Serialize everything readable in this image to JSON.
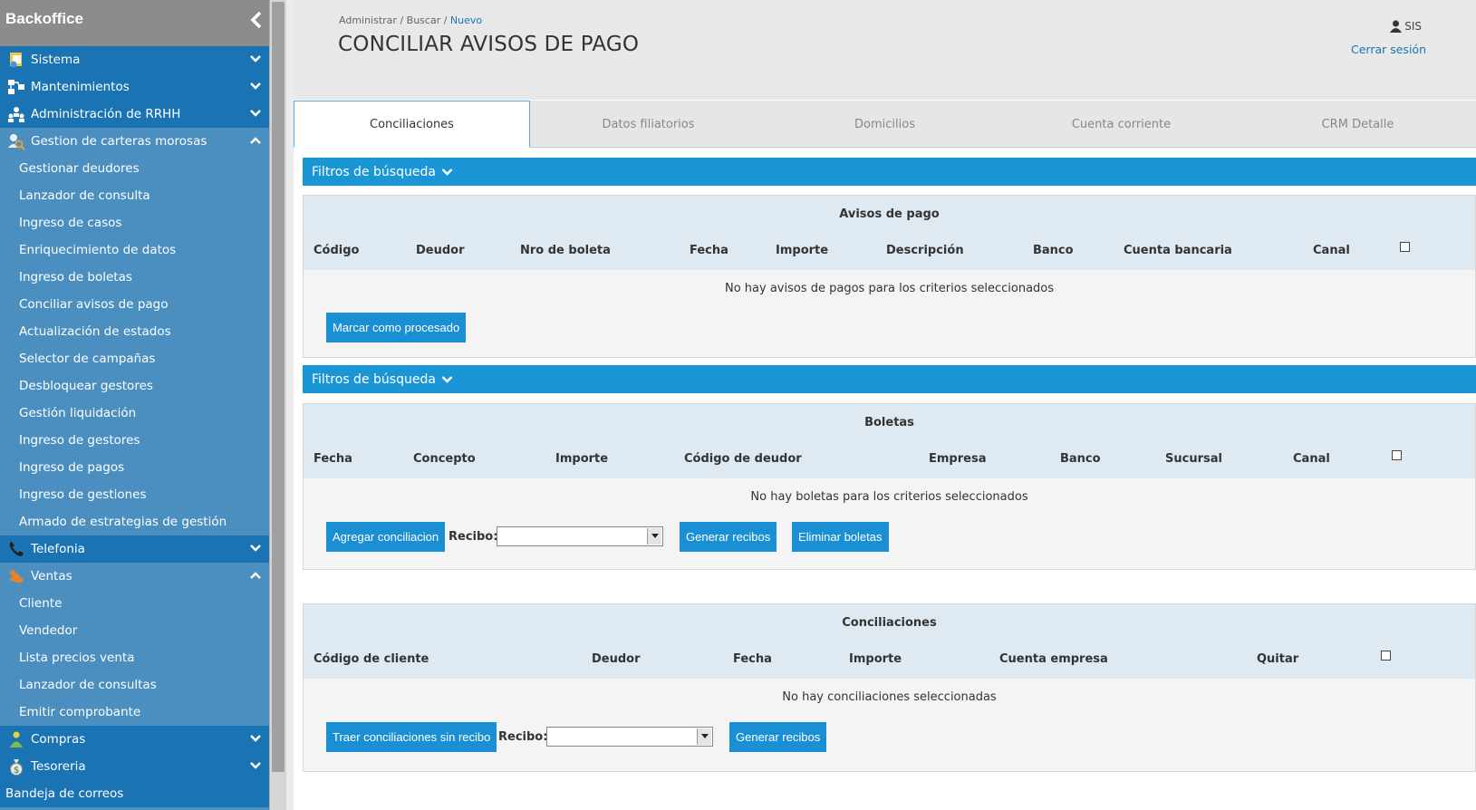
{
  "sidebar": {
    "title": "Backoffice",
    "sections": [
      {
        "label": "Sistema",
        "expanded": false,
        "icon": "sistema-icon"
      },
      {
        "label": "Mantenimientos",
        "expanded": false,
        "icon": "mantenimientos-icon"
      },
      {
        "label": "Administración de RRHH",
        "expanded": false,
        "icon": "rrhh-icon"
      },
      {
        "label": "Gestion de carteras morosas",
        "expanded": true,
        "icon": "search-user-icon"
      }
    ],
    "carteras_items": [
      "Gestionar deudores",
      "Lanzador de consulta",
      "Ingreso de casos",
      "Enriquecimiento de datos",
      "Ingreso de boletas",
      "Conciliar avisos de pago",
      "Actualización de estados",
      "Selector de campañas",
      "Desbloquear gestores",
      "Gestión liquidación",
      "Ingreso de gestores",
      "Ingreso de pagos",
      "Ingreso de gestiones",
      "Armado de estrategias de gestión"
    ],
    "telefonia": "Telefonia",
    "ventas": "Ventas",
    "ventas_items": [
      "Cliente",
      "Vendedor",
      "Lista precios venta",
      "Lanzador de consultas",
      "Emitir comprobante"
    ],
    "compras": "Compras",
    "tesoreria": "Tesoreria",
    "bandeja": "Bandeja de correos"
  },
  "header": {
    "breadcrumb": {
      "b1": "Administrar",
      "sep": " / ",
      "b2": "Buscar",
      "b3": "Nuevo"
    },
    "title": "CONCILIAR AVISOS DE PAGO",
    "user": "SIS",
    "logout": "Cerrar sesión"
  },
  "tabs": [
    "Conciliaciones",
    "Datos filiatorios",
    "Domicilios",
    "Cuenta corriente",
    "CRM Detalle"
  ],
  "filters_label": "Filtros de búsqueda",
  "avisos": {
    "title": "Avisos de pago",
    "columns": [
      "Código",
      "Deudor",
      "Nro de boleta",
      "Fecha",
      "Importe",
      "Descripción",
      "Banco",
      "Cuenta bancaria",
      "Canal"
    ],
    "empty": "No hay avisos de pagos para los criterios seleccionados",
    "button": "Marcar como procesado"
  },
  "boletas": {
    "title": "Boletas",
    "columns": [
      "Fecha",
      "Concepto",
      "Importe",
      "Código de deudor",
      "Empresa",
      "Banco",
      "Sucursal",
      "Canal"
    ],
    "empty": "No hay boletas para los criterios seleccionados",
    "btn_agregar": "Agregar conciliacion",
    "recibo_label": "Recibo:",
    "btn_generar": "Generar recibos",
    "btn_eliminar": "Eliminar boletas"
  },
  "conciliaciones": {
    "title": "Conciliaciones",
    "columns": [
      "Código de cliente",
      "Deudor",
      "Fecha",
      "Importe",
      "Cuenta empresa",
      "Quitar"
    ],
    "empty": "No hay conciliaciones seleccionadas",
    "btn_traer": "Traer conciliaciones sin recibo",
    "recibo_label": "Recibo:",
    "btn_generar": "Generar recibos"
  }
}
